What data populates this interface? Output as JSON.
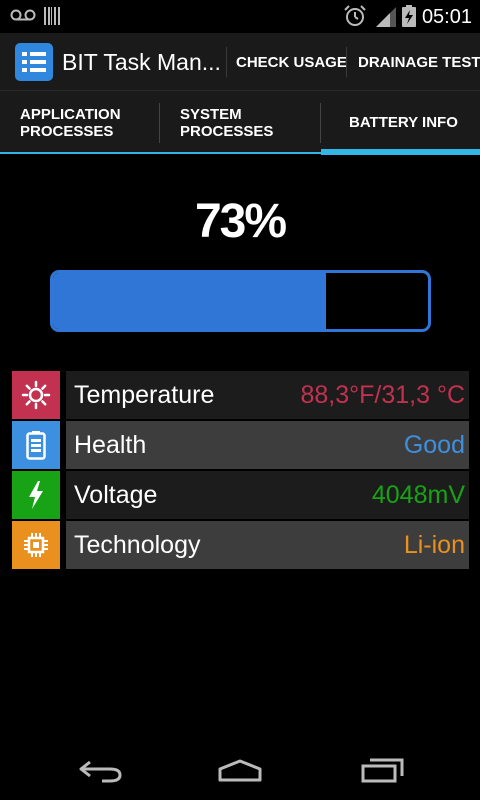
{
  "status_bar": {
    "time": "05:01",
    "icons": [
      "voicemail-icon",
      "barcode-icon",
      "alarm-icon",
      "signal-icon",
      "battery-charging-icon"
    ]
  },
  "action_bar": {
    "title": "BIT Task Man...",
    "check_usage_label": "CHECK USAGE",
    "drainage_test_label": "DRAINAGE TEST"
  },
  "tabs": [
    {
      "line1": "APPLICATION",
      "line2": "PROCESSES",
      "active": false
    },
    {
      "line1": "SYSTEM",
      "line2": "PROCESSES",
      "active": false
    },
    {
      "line1": "BATTERY INFO",
      "line2": "",
      "active": true
    }
  ],
  "battery": {
    "percent_label": "73%",
    "level": 0.73
  },
  "info_rows": [
    {
      "label": "Temperature",
      "value": "88,3°F/31,3 °C",
      "value_color": "#c2314f",
      "icon_bg": "#c2314f",
      "icon": "sun-icon"
    },
    {
      "label": "Health",
      "value": "Good",
      "value_color": "#3d8fe0",
      "icon_bg": "#3d8fe0",
      "icon": "battery-icon"
    },
    {
      "label": "Voltage",
      "value": "4048mV",
      "value_color": "#18a316",
      "icon_bg": "#18a316",
      "icon": "lightning-icon"
    },
    {
      "label": "Technology",
      "value": "Li-ion",
      "value_color": "#e9901f",
      "icon_bg": "#e9901f",
      "icon": "chip-icon"
    }
  ],
  "colors": {
    "accent": "#33b5e5",
    "battery_fill": "#2f76d6"
  }
}
